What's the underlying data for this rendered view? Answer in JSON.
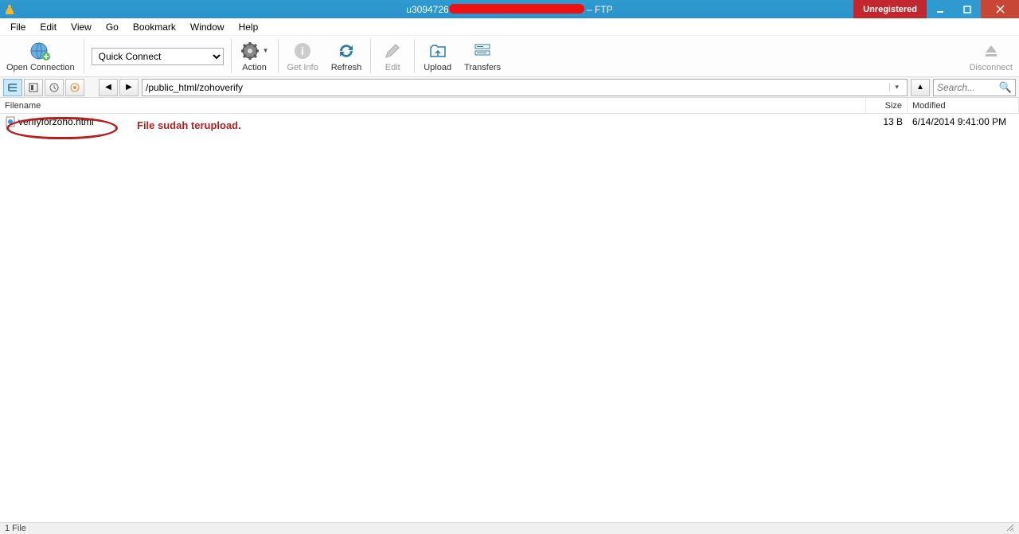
{
  "title": {
    "user_prefix": "u3094726",
    "suffix": " – FTP",
    "unregistered": "Unregistered"
  },
  "menu": {
    "file": "File",
    "edit": "Edit",
    "view": "View",
    "go": "Go",
    "bookmark": "Bookmark",
    "window": "Window",
    "help": "Help"
  },
  "toolbar": {
    "open_connection": "Open Connection",
    "quick_connect": "Quick Connect",
    "action": "Action",
    "get_info": "Get Info",
    "refresh": "Refresh",
    "edit": "Edit",
    "upload": "Upload",
    "transfers": "Transfers",
    "disconnect": "Disconnect"
  },
  "nav": {
    "path": "/public_html/zohoverify",
    "search_placeholder": "Search..."
  },
  "columns": {
    "filename": "Filename",
    "size": "Size",
    "modified": "Modified"
  },
  "files": [
    {
      "name": "verifyforzoho.html",
      "size": "13 B",
      "modified": "6/14/2014 9:41:00 PM"
    }
  ],
  "annotation": "File sudah terupload.",
  "status": {
    "left": "1 File",
    "right": ""
  }
}
